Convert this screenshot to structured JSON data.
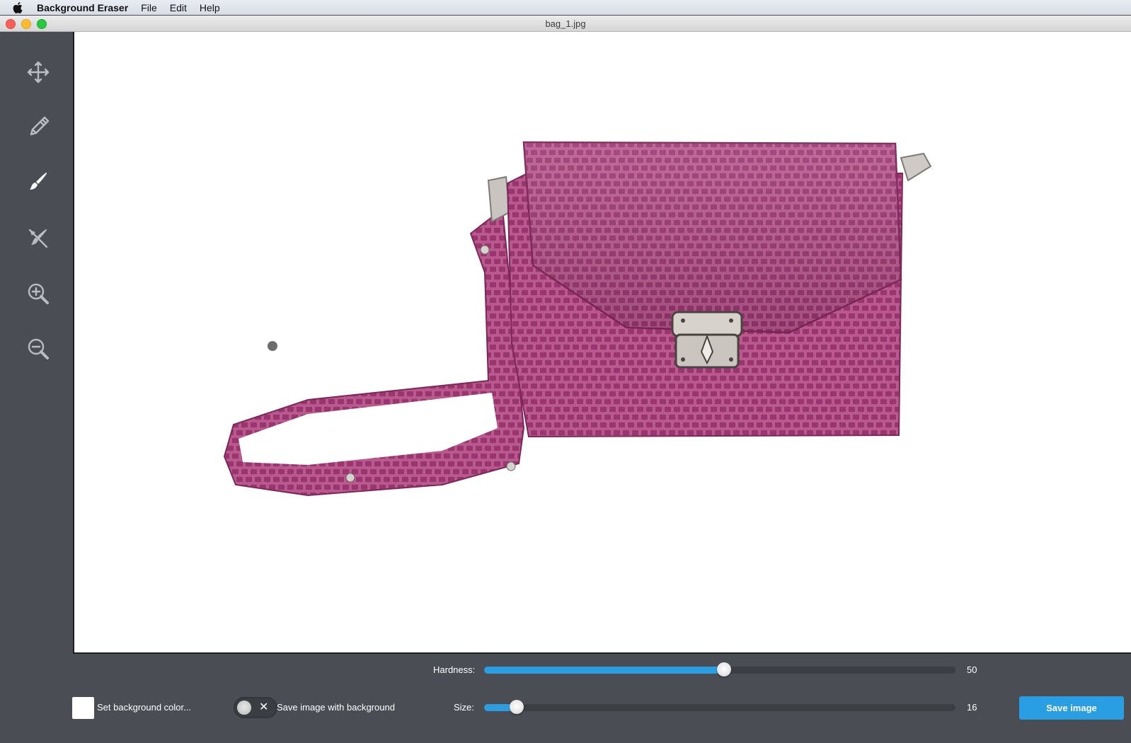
{
  "menubar": {
    "app_name": "Background Eraser",
    "items": [
      "File",
      "Edit",
      "Help"
    ]
  },
  "window": {
    "title": "bag_1.jpg"
  },
  "toolbar": {
    "tools": [
      {
        "icon": "move-icon",
        "active": false
      },
      {
        "icon": "pencil-icon",
        "active": false
      },
      {
        "icon": "brush-icon",
        "active": true
      },
      {
        "icon": "restore-brush-icon",
        "active": false
      },
      {
        "icon": "zoom-in-icon",
        "active": false
      },
      {
        "icon": "zoom-out-icon",
        "active": false
      }
    ]
  },
  "canvas": {
    "image_subject": "magenta crocodile-textured leather crossbody handbag with silver clasp"
  },
  "controls": {
    "hardness_label": "Hardness:",
    "hardness_value": "50",
    "hardness_fraction": 0.5,
    "size_label": "Size:",
    "size_value": "16",
    "size_fraction": 0.06,
    "set_bg_label": "Set background color...",
    "save_with_bg_label": "Save image with background",
    "save_with_bg_enabled": false,
    "save_button_label": "Save image"
  },
  "colors": {
    "accent": "#2a9ee3",
    "panel": "#4a4e54",
    "bag": "#a83f78"
  }
}
